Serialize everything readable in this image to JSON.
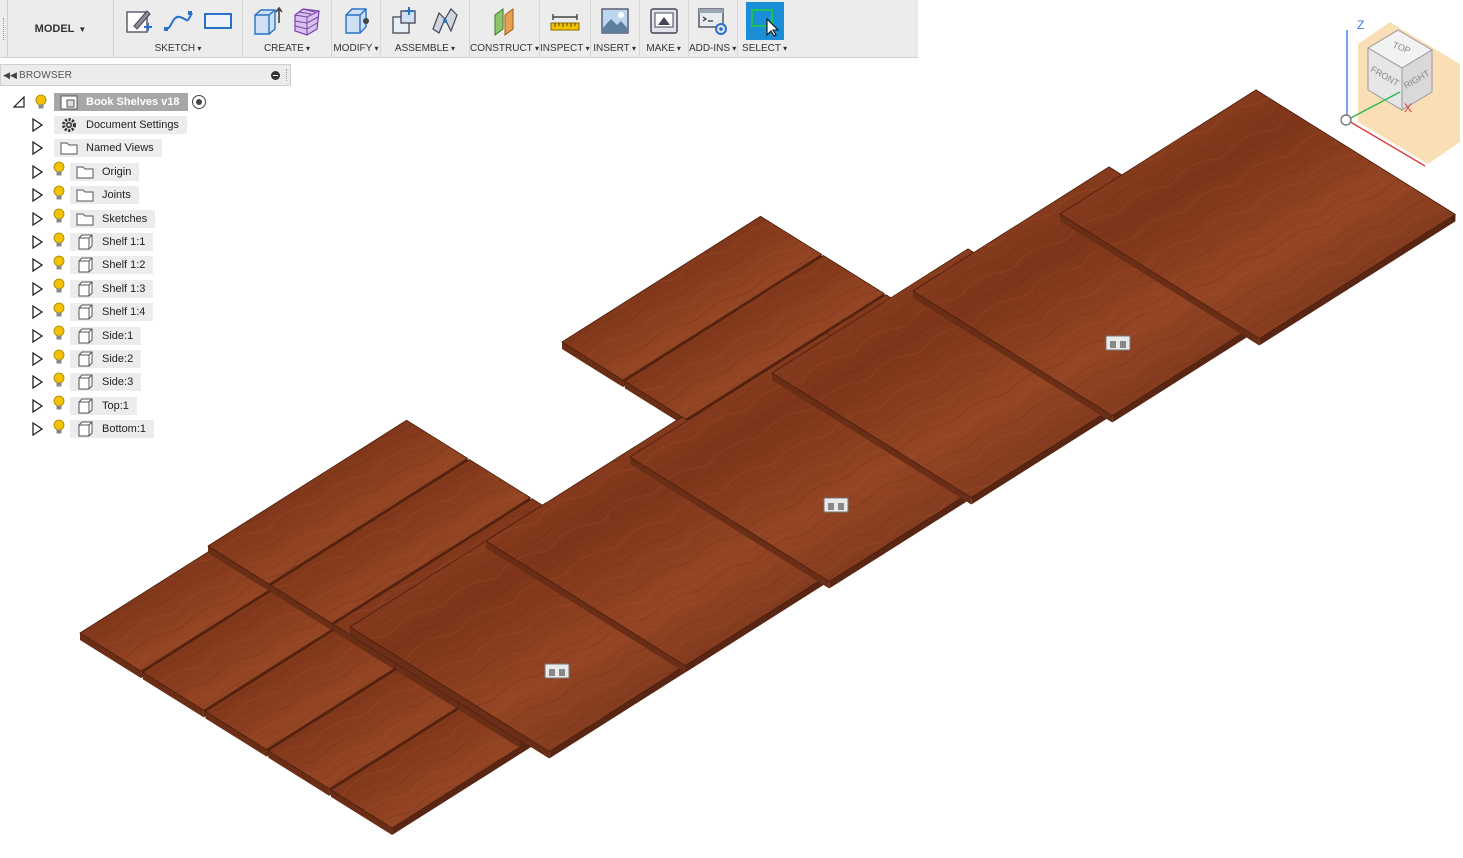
{
  "app": {
    "workspace": "MODEL"
  },
  "toolbar": {
    "groups": [
      {
        "label": "SKETCH"
      },
      {
        "label": "CREATE"
      },
      {
        "label": "MODIFY"
      },
      {
        "label": "ASSEMBLE"
      },
      {
        "label": "CONSTRUCT"
      },
      {
        "label": "INSPECT"
      },
      {
        "label": "INSERT"
      },
      {
        "label": "MAKE"
      },
      {
        "label": "ADD-INS"
      },
      {
        "label": "SELECT"
      }
    ]
  },
  "browser": {
    "title": "BROWSER",
    "root": {
      "label": "Book Shelves v18"
    },
    "items": [
      {
        "label": "Document Settings",
        "icon": "gear-icon",
        "visible_toggle": false
      },
      {
        "label": "Named Views",
        "icon": "folder-icon",
        "visible_toggle": false
      },
      {
        "label": "Origin",
        "icon": "folder-icon",
        "visible_toggle": true
      },
      {
        "label": "Joints",
        "icon": "folder-icon",
        "visible_toggle": true
      },
      {
        "label": "Sketches",
        "icon": "folder-icon",
        "visible_toggle": true
      },
      {
        "label": "Shelf 1:1",
        "icon": "component-icon",
        "visible_toggle": true
      },
      {
        "label": "Shelf 1:2",
        "icon": "component-icon",
        "visible_toggle": true
      },
      {
        "label": "Shelf 1:3",
        "icon": "component-icon",
        "visible_toggle": true
      },
      {
        "label": "Shelf 1:4",
        "icon": "component-icon",
        "visible_toggle": true
      },
      {
        "label": "Side:1",
        "icon": "component-icon",
        "visible_toggle": true
      },
      {
        "label": "Side:2",
        "icon": "component-icon",
        "visible_toggle": true
      },
      {
        "label": "Side:3",
        "icon": "component-icon",
        "visible_toggle": true
      },
      {
        "label": "Top:1",
        "icon": "component-icon",
        "visible_toggle": true
      },
      {
        "label": "Bottom:1",
        "icon": "component-icon",
        "visible_toggle": true
      }
    ]
  },
  "viewcube": {
    "top": "TOP",
    "front": "FRONT",
    "right": "RIGHT",
    "axis_z": "Z",
    "axis_x": "X"
  },
  "colors": {
    "wood_top": "#8a3f22",
    "wood_edge": "#5a2614",
    "accent_select": "#1a8fd8",
    "bulb": "#f2c200"
  }
}
